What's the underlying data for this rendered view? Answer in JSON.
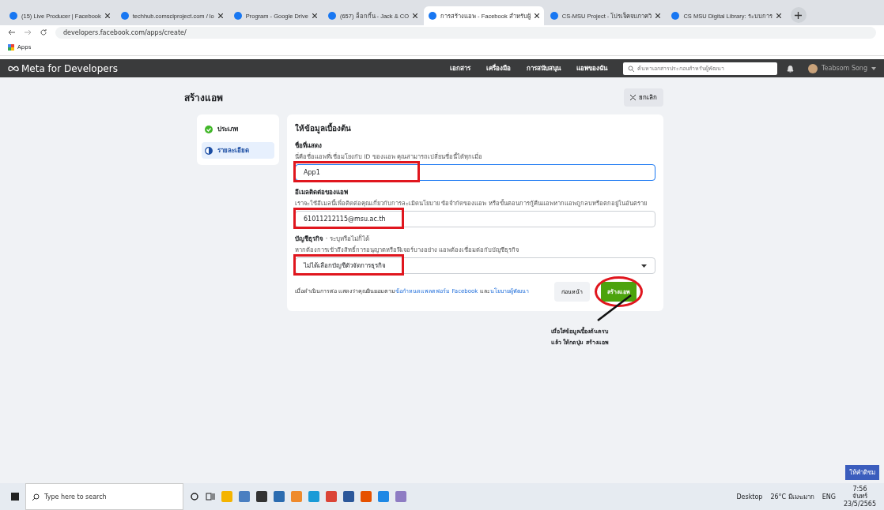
{
  "browser_tabs": [
    {
      "title": "(15) Live Producer | Facebook",
      "selected": false
    },
    {
      "title": "techhub.comsciproject.com / lo",
      "selected": false
    },
    {
      "title": "Program - Google Drive",
      "selected": false
    },
    {
      "title": "(657) ล็อกกิ้น - Jack & CO",
      "selected": false
    },
    {
      "title": "การสร้างแอพ - Facebook สำหรับผู้",
      "selected": true
    },
    {
      "title": "CS-MSU Project - โปรเจ็คจบภาควิ",
      "selected": false
    },
    {
      "title": "CS MSU Digital Library: ระบบการ",
      "selected": false
    }
  ],
  "address_bar": {
    "url": "developers.facebook.com/apps/create/"
  },
  "bookmarks": [
    "Apps"
  ],
  "top_nav": {
    "logo": "Meta for Developers",
    "links": [
      "เอกสาร",
      "เครื่องมือ",
      "การสนับสนุน",
      "แอพของฉัน"
    ],
    "search": {
      "placeholder": "ค้นหาเอกสารประกอบสำหรับผู้พัฒนา"
    },
    "user": "Teabsom Song"
  },
  "page": {
    "title": "สร้างแอพ",
    "cancel_button": "ยกเลิก"
  },
  "steps": [
    {
      "label": "ประเภท",
      "done": true,
      "selected": false
    },
    {
      "label": "รายละเอียด",
      "done": false,
      "selected": true
    }
  ],
  "form": {
    "heading": "ให้ข้อมูลเบื้องต้น",
    "fields": [
      {
        "kind": "text",
        "label": "ชื่อที่แสดง",
        "hint": "นี่คือชื่อแอพที่เชื่อมโยงกับ ID ของแอพ คุณสามารถเปลี่ยนชื่อนี้ได้ทุกเมื่อ",
        "value": "App1",
        "focused": true,
        "highlighted": true
      },
      {
        "kind": "text",
        "label": "อีเมลติดต่อของแอพ",
        "hint": "เราจะใช้อีเมลนี้เพื่อติดต่อคุณเกี่ยวกับการละเมิดนโยบาย ข้อจำกัดของแอพ หรือขั้นตอนการกู้คืนแอพหากแอพถูกลบหรือตกอยู่ในอันตราย",
        "value": "61011212115@msu.ac.th",
        "focused": false,
        "highlighted": true
      },
      {
        "kind": "select",
        "label": "บัญชีธุรกิจ",
        "optional": "· ระบุหรือไม่ก็ได้",
        "hint": "หากต้องการเข้าถึงสิทธิ์การอนุญาตหรือฟีเจอร์บางอย่าง แอพต้องเชื่อมต่อกับบัญชีธุรกิจ",
        "value": "ไม่ได้เลือกบัญชีตัวจัดการธุรกิจ",
        "focused": false,
        "highlighted": true
      }
    ],
    "terms": {
      "before": "เมื่อดำเนินการต่อ แสดงว่าคุณยินยอมตาม",
      "link_1": "ข้อกำหนดแพลตฟอร์ม Facebook",
      "middle": " และ",
      "link_2": "นโยบายผู้พัฒนา"
    },
    "back_button": "ก่อนหน้า",
    "create_button": "สร้างแอพ"
  },
  "annotation": {
    "lines": [
      "เมื่อใส่ข้อมูลเบื้องต้นครบ",
      "แล้ว ให้กดปุ่ม สร้างแอพ"
    ]
  },
  "feedback_button": "ให้คำติชม",
  "taskbar": {
    "search_placeholder": "Type here to search",
    "desktop": "Desktop",
    "weather": "26°C มีเมฆมาก",
    "language": "ENG",
    "time": "7:56",
    "day": "จันทร์",
    "date": "23/5/2565"
  }
}
